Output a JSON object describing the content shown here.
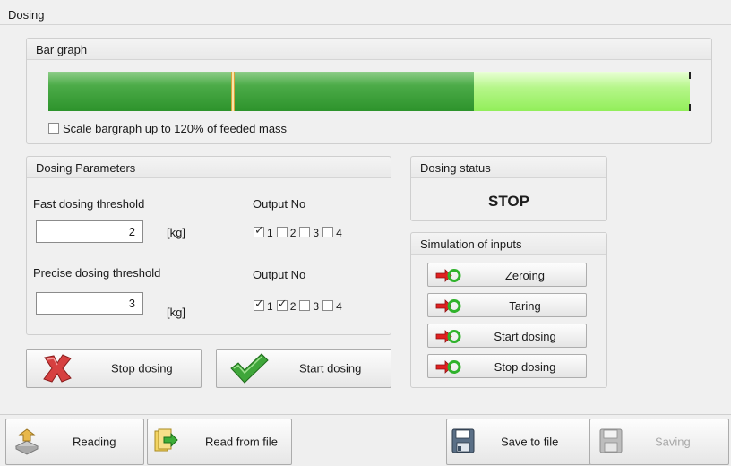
{
  "window": {
    "tab_title": "Dosing"
  },
  "bar_graph": {
    "title": "Bar graph",
    "dark_fill_fraction": 0.664,
    "light_fill_fraction": 1.0,
    "marker_fraction": 0.285,
    "scale_checkbox": {
      "checked": false,
      "label": "Scale bargraph up to 120% of feeded mass"
    }
  },
  "dosing_parameters": {
    "title": "Dosing Parameters",
    "fast": {
      "label": "Fast dosing threshold",
      "value": "2",
      "unit": "[kg]",
      "output_label": "Output No",
      "outputs": [
        {
          "n": "1",
          "checked": true
        },
        {
          "n": "2",
          "checked": false
        },
        {
          "n": "3",
          "checked": false
        },
        {
          "n": "4",
          "checked": false
        }
      ]
    },
    "precise": {
      "label": "Precise dosing threshold",
      "value": "3",
      "unit": "[kg]",
      "output_label": "Output No",
      "outputs": [
        {
          "n": "1",
          "checked": true
        },
        {
          "n": "2",
          "checked": true
        },
        {
          "n": "3",
          "checked": false
        },
        {
          "n": "4",
          "checked": false
        }
      ]
    }
  },
  "actions": {
    "stop_label": "Stop dosing",
    "start_label": "Start dosing"
  },
  "dosing_status": {
    "title": "Dosing status",
    "value": "STOP"
  },
  "simulation": {
    "title": "Simulation of inputs",
    "buttons": [
      {
        "label": "Zeroing",
        "icon": "input-arrow-icon"
      },
      {
        "label": "Taring",
        "icon": "input-arrow-icon"
      },
      {
        "label": "Start dosing",
        "icon": "input-arrow-icon"
      },
      {
        "label": "Stop dosing",
        "icon": "input-arrow-icon"
      }
    ]
  },
  "toolbar": {
    "reading_label": "Reading",
    "read_from_file_label": "Read from file",
    "save_to_file_label": "Save to file",
    "saving_label": "Saving"
  },
  "colors": {
    "bar_dark": "#3c9f3a",
    "bar_light": "#a6f273",
    "marker": "#e3b04b",
    "stop_red": "#d64040",
    "start_green": "#3fa63a",
    "sim_arrow_red": "#e02020",
    "sim_ring_green": "#2fb22b"
  }
}
